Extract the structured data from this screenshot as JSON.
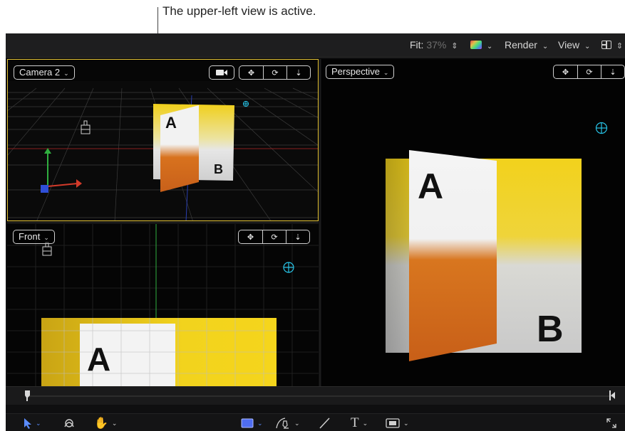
{
  "callout": {
    "text": "The upper-left view is active."
  },
  "toolbar": {
    "fit_label": "Fit:",
    "fit_value": "37%",
    "render_label": "Render",
    "view_label": "View",
    "color_icon": "color-channels-icon",
    "layout_icon": "viewport-layout-icon"
  },
  "viewports": {
    "upper_left": {
      "camera_label": "Camera 2",
      "active_border_color": "#e2c133",
      "controls": [
        "camera-icon",
        "pan-icon",
        "orbit-icon",
        "dolly-icon"
      ]
    },
    "right": {
      "camera_label": "Perspective",
      "controls": [
        "pan-icon",
        "orbit-icon",
        "dolly-icon"
      ]
    },
    "lower_left": {
      "camera_label": "Front",
      "controls": [
        "pan-icon",
        "orbit-icon",
        "dolly-icon"
      ]
    }
  },
  "canvas_content": {
    "letter_a": "A",
    "letter_b": "B"
  },
  "bottom_tools": [
    "select-arrow-icon",
    "transform-icon",
    "hand-icon",
    "rectangle-shape-icon",
    "pen-icon",
    "paint-stroke-icon",
    "text-icon",
    "mask-icon",
    "expand-icon"
  ],
  "colors": {
    "active_view": "#e2c133",
    "yellow_layer": "#f0cf1a",
    "orange": "#d4681c",
    "cyan_guide": "#27c3e6"
  }
}
